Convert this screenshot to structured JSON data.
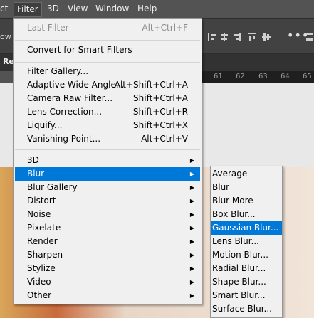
{
  "menubar": {
    "items": [
      {
        "label": "ct"
      },
      {
        "label": "Filter"
      },
      {
        "label": "3D"
      },
      {
        "label": "View"
      },
      {
        "label": "Window"
      },
      {
        "label": "Help"
      }
    ]
  },
  "optbar": {
    "left_text": "ow",
    "more_icon": "ellipsis-icon"
  },
  "tabbar": {
    "text": "Re"
  },
  "ruler": {
    "ticks": [
      "61",
      "62",
      "63",
      "64",
      "65"
    ]
  },
  "filter_menu": {
    "last_filter": {
      "label": "Last Filter",
      "shortcut": "Alt+Ctrl+F"
    },
    "convert": {
      "label": "Convert for Smart Filters"
    },
    "group1": [
      {
        "label": "Filter Gallery...",
        "shortcut": ""
      },
      {
        "label": "Adaptive Wide Angle...",
        "shortcut": "Alt+Shift+Ctrl+A"
      },
      {
        "label": "Camera Raw Filter...",
        "shortcut": "Shift+Ctrl+A"
      },
      {
        "label": "Lens Correction...",
        "shortcut": "Shift+Ctrl+R"
      },
      {
        "label": "Liquify...",
        "shortcut": "Shift+Ctrl+X"
      },
      {
        "label": "Vanishing Point...",
        "shortcut": "Alt+Ctrl+V"
      }
    ],
    "submenus": [
      {
        "label": "3D"
      },
      {
        "label": "Blur"
      },
      {
        "label": "Blur Gallery"
      },
      {
        "label": "Distort"
      },
      {
        "label": "Noise"
      },
      {
        "label": "Pixelate"
      },
      {
        "label": "Render"
      },
      {
        "label": "Sharpen"
      },
      {
        "label": "Stylize"
      },
      {
        "label": "Video"
      },
      {
        "label": "Other"
      }
    ],
    "arrow": "▶"
  },
  "blur_submenu": {
    "items": [
      {
        "label": "Average"
      },
      {
        "label": "Blur"
      },
      {
        "label": "Blur More"
      },
      {
        "label": "Box Blur..."
      },
      {
        "label": "Gaussian Blur..."
      },
      {
        "label": "Lens Blur..."
      },
      {
        "label": "Motion Blur..."
      },
      {
        "label": "Radial Blur..."
      },
      {
        "label": "Shape Blur..."
      },
      {
        "label": "Smart Blur..."
      },
      {
        "label": "Surface Blur..."
      }
    ]
  },
  "colors": {
    "highlight": "#0078d7",
    "menu_bg": "#f0f0f0",
    "app_bg": "#535353"
  }
}
